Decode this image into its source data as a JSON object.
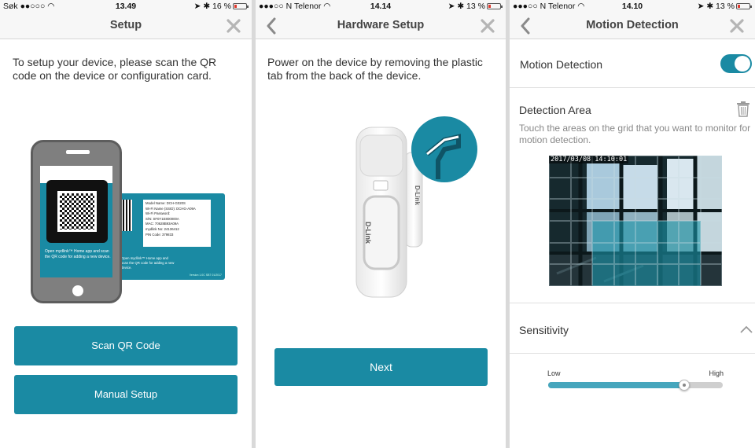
{
  "screens": [
    {
      "status": {
        "left": "Søk ●●○○○ ◠",
        "time": "13.49",
        "right": "➤ ✱ 16 %"
      },
      "title": "Setup",
      "instruction": "To setup your device, please scan the QR code on the device or configuration card.",
      "card": {
        "model": "Model Name: DCH-G020S",
        "wifi_name": "Wi-Fi Name (SSID): DCHG-A09A",
        "wifi_password": "Wi-Fi Password:",
        "sn": "S/N: SF0Y1E800000A",
        "mac": "MAC: 70628B93A09A",
        "mydlink_no": "mydlink No: 24136412",
        "pin": "PIN Code: 379833",
        "footer": "Open mydlink™ Home app and scan the QR code for adding a new device.",
        "version": "Version 1.0C SB7 01/2017"
      },
      "buttons": {
        "scan": "Scan QR Code",
        "manual": "Manual Setup"
      }
    },
    {
      "status": {
        "left": "●●●○○ N Telenor ◠",
        "time": "14.14",
        "right": "➤ ✱ 13 %"
      },
      "title": "Hardware Setup",
      "instruction": "Power on the device by removing the plastic tab from the back of the device.",
      "device_brand": "D-Link",
      "buttons": {
        "next": "Next"
      }
    },
    {
      "status": {
        "left": "●●●○○ N Telenor ◠",
        "time": "14.10",
        "right": "➤ ✱ 13 %"
      },
      "title": "Motion Detection",
      "motion_label": "Motion Detection",
      "motion_enabled": true,
      "area_label": "Detection Area",
      "area_hint": "Touch the areas on the grid that you want to monitor for motion detection.",
      "timestamp": "2017/03/08  14:10:01",
      "grid": {
        "cols": 8,
        "rows": 6,
        "selected_rows": [
          3,
          4,
          5
        ],
        "selected_cols": [
          2,
          3,
          4,
          5,
          6
        ]
      },
      "sensitivity_label": "Sensitivity",
      "sensitivity_low": "Low",
      "sensitivity_high": "High",
      "sensitivity_value": 0.78
    }
  ],
  "colors": {
    "accent": "#1a8aa3",
    "close_icon": "#b5b5b5",
    "back_icon": "#8a8a8a"
  }
}
